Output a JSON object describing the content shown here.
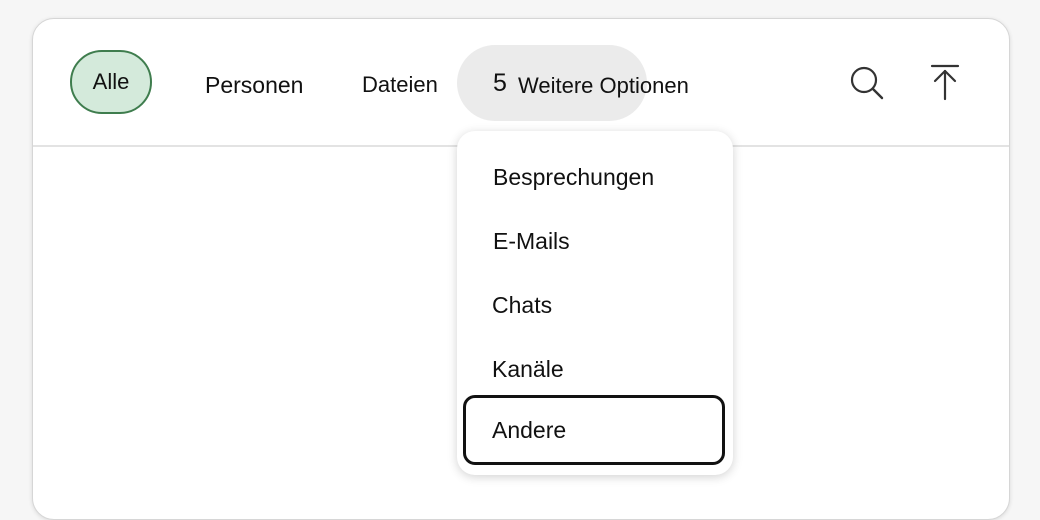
{
  "tabs": {
    "all": "Alle",
    "people": "Personen",
    "files": "Dateien",
    "more_count": "5",
    "more_label": "Weitere Optionen"
  },
  "icons": {
    "search": "search-icon",
    "scroll_top": "arrow-up-to-top-icon"
  },
  "menu": {
    "items": [
      {
        "label": "Besprechungen"
      },
      {
        "label": "E-Mails"
      },
      {
        "label": "Chats"
      },
      {
        "label": "Kanäle"
      },
      {
        "label": "Andere"
      }
    ],
    "focused_index": 4
  },
  "colors": {
    "active_pill_bg": "#d4eadb",
    "active_pill_border": "#3f7d4e",
    "more_pill_bg": "#ebebeb",
    "focus_outline": "#111111"
  }
}
